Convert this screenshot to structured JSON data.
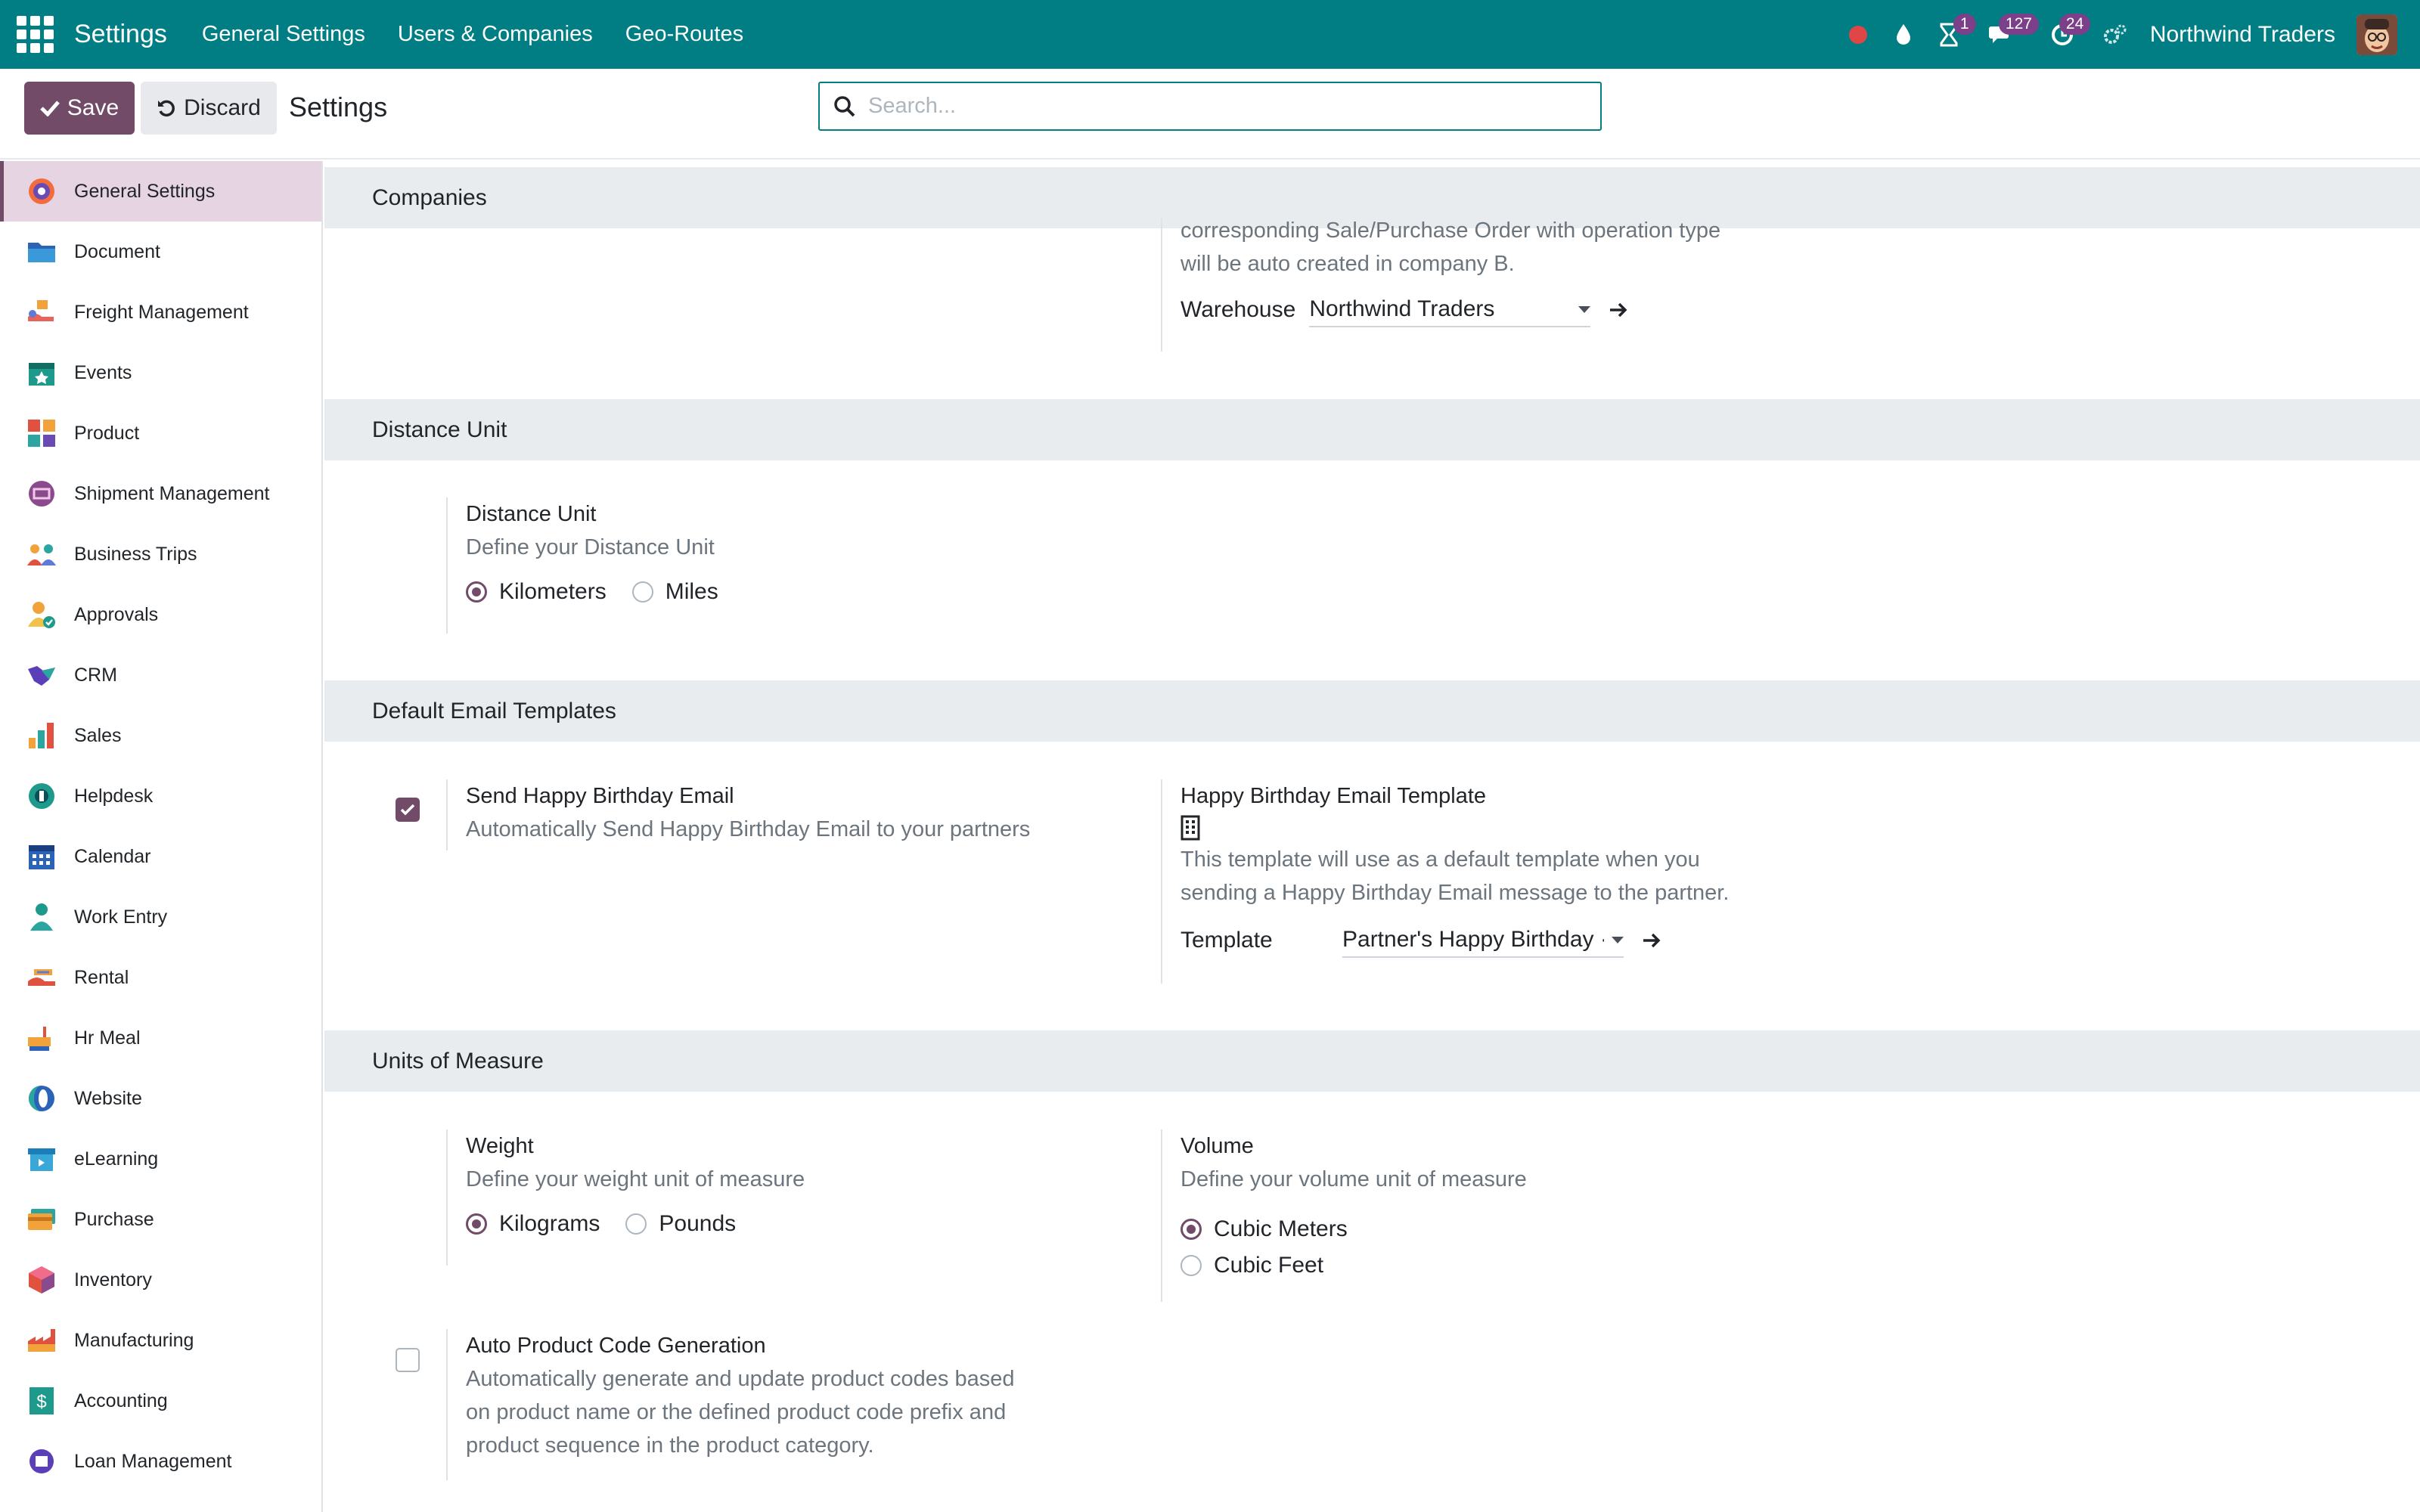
{
  "navbar": {
    "brand": "Settings",
    "menus": [
      "General Settings",
      "Users & Companies",
      "Geo-Routes"
    ],
    "badges": {
      "activities": "1",
      "messages": "127",
      "timer": "24"
    },
    "company": "Northwind Traders",
    "accent": "#017e84"
  },
  "control": {
    "save_label": "Save",
    "discard_label": "Discard",
    "title": "Settings",
    "search_placeholder": "Search..."
  },
  "sidebar": {
    "items": [
      {
        "label": "General Settings",
        "icon": "settings-app-icon"
      },
      {
        "label": "Document",
        "icon": "folder-icon"
      },
      {
        "label": "Freight Management",
        "icon": "freight-icon"
      },
      {
        "label": "Events",
        "icon": "calendar-star-icon"
      },
      {
        "label": "Product",
        "icon": "product-blocks-icon"
      },
      {
        "label": "Shipment Management",
        "icon": "shipment-icon"
      },
      {
        "label": "Business Trips",
        "icon": "people-icon"
      },
      {
        "label": "Approvals",
        "icon": "approval-user-icon"
      },
      {
        "label": "CRM",
        "icon": "handshake-icon"
      },
      {
        "label": "Sales",
        "icon": "bar-chart-icon"
      },
      {
        "label": "Helpdesk",
        "icon": "lifebuoy-icon"
      },
      {
        "label": "Calendar",
        "icon": "calendar-icon"
      },
      {
        "label": "Work Entry",
        "icon": "user-clock-icon"
      },
      {
        "label": "Rental",
        "icon": "rental-hand-icon"
      },
      {
        "label": "Hr Meal",
        "icon": "meal-icon"
      },
      {
        "label": "Website",
        "icon": "globe-icon"
      },
      {
        "label": "eLearning",
        "icon": "elearning-icon"
      },
      {
        "label": "Purchase",
        "icon": "credit-card-icon"
      },
      {
        "label": "Inventory",
        "icon": "cube-icon"
      },
      {
        "label": "Manufacturing",
        "icon": "factory-icon"
      },
      {
        "label": "Accounting",
        "icon": "dollar-doc-icon"
      },
      {
        "label": "Loan Management",
        "icon": "loan-icon"
      }
    ]
  },
  "companies": {
    "header": "Companies",
    "desc_line1": "corresponding Sale/Purchase Order with operation type",
    "desc_line2": "will be auto created in company B.",
    "warehouse_label": "Warehouse",
    "warehouse_value": "Northwind Traders"
  },
  "distance": {
    "header": "Distance Unit",
    "title": "Distance Unit",
    "desc": "Define your Distance Unit",
    "options": [
      "Kilometers",
      "Miles"
    ],
    "selected": "Kilometers"
  },
  "email_templates": {
    "header": "Default Email Templates",
    "birthday_title": "Send Happy Birthday Email",
    "birthday_desc": "Automatically Send Happy Birthday Email to your partners",
    "birthday_checked": true,
    "template_title": "Happy Birthday Email Template",
    "template_desc_line1": "This template will use as a default template when you",
    "template_desc_line2": "sending a Happy Birthday Email message to the partner.",
    "template_label": "Template",
    "template_value": "Partner's Happy Birthday ·"
  },
  "uom": {
    "header": "Units of Measure",
    "weight_title": "Weight",
    "weight_desc": "Define your weight unit of measure",
    "weight_options": [
      "Kilograms",
      "Pounds"
    ],
    "weight_selected": "Kilograms",
    "volume_title": "Volume",
    "volume_desc": "Define your volume unit of measure",
    "volume_options": [
      "Cubic Meters",
      "Cubic Feet"
    ],
    "volume_selected": "Cubic Meters",
    "autocode_title": "Auto Product Code Generation",
    "autocode_desc_line1": "Automatically generate and update product codes based",
    "autocode_desc_line2": "on product name or the defined product code prefix and",
    "autocode_desc_line3": "product sequence in the product category.",
    "autocode_checked": false
  }
}
